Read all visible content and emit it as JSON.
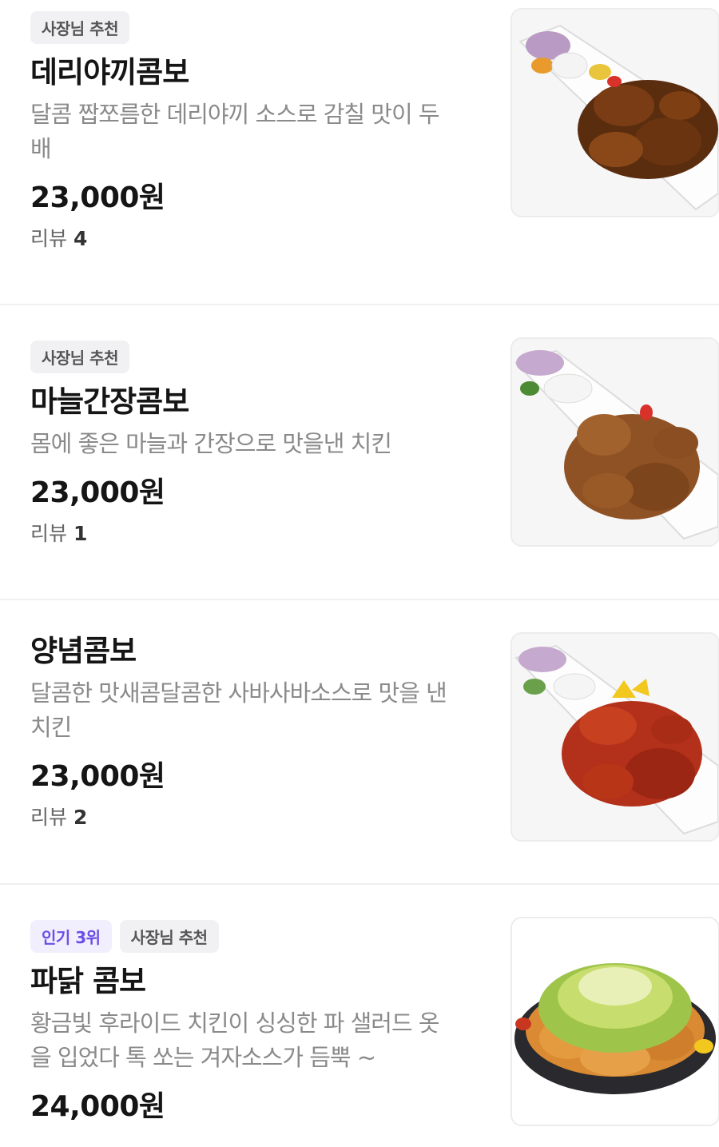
{
  "menu_items": [
    {
      "badges": [
        "사장님 추천"
      ],
      "name": "데리야끼콤보",
      "description_lines": [
        "달콤 짭쪼름한 데리야끼 소스로 감칠 맛이 두",
        "배"
      ],
      "price": "23,000원",
      "review_label": "리뷰",
      "review_count": "4",
      "image_icon": "teriyaki-chicken-plate"
    },
    {
      "badges": [
        "사장님 추천"
      ],
      "name": "마늘간장콤보",
      "description_lines": [
        "몸에 좋은 마늘과 간장으로 맛을낸 치킨"
      ],
      "price": "23,000원",
      "review_label": "리뷰",
      "review_count": "1",
      "image_icon": "garlic-soy-chicken-plate"
    },
    {
      "badges": [],
      "name": "양념콤보",
      "description_lines": [
        "달콤한 맛새콤달콤한 사바사바소스로 맛을 낸",
        "치킨"
      ],
      "price": "23,000원",
      "review_label": "리뷰",
      "review_count": "2",
      "image_icon": "spicy-sauce-chicken-plate"
    },
    {
      "badges_popular": "인기 3위",
      "badges": [
        "사장님 추천"
      ],
      "name": "파닭 콤보",
      "description_lines": [
        "황금빛 후라이드 치킨이 싱싱한 파 샐러드 옷",
        "을 입었다 톡 쏘는 겨자소스가 듬뿍 ~"
      ],
      "price": "24,000원",
      "image_icon": "green-onion-chicken-bowl"
    }
  ],
  "colors": {
    "badge_bg": "#f1f1f3",
    "badge_text": "#555555",
    "popular_badge_bg": "#f1eefe",
    "popular_badge_text": "#6b4ee6",
    "description": "#8a8a8a",
    "title": "#151515"
  }
}
